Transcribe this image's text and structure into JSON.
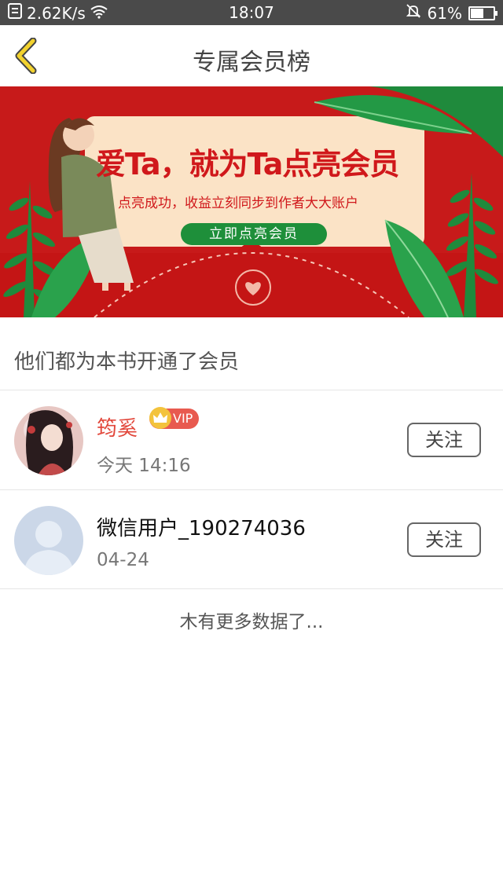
{
  "status_bar": {
    "speed": "2.62K/s",
    "time": "18:07",
    "battery": "61%",
    "battery_level": 0.61
  },
  "header": {
    "title": "专属会员榜"
  },
  "banner": {
    "headline": "爱Ta，就为Ta点亮会员",
    "subtitle": "点亮成功，收益立刻同步到作者大大账户",
    "button_label": "立即点亮会员"
  },
  "section": {
    "title": "他们都为本书开通了会员"
  },
  "members": [
    {
      "name": "筠奚",
      "time": "今天 14:16",
      "badge": "VIP",
      "follow_label": "关注"
    },
    {
      "name": "微信用户_190274036",
      "time": "04-24",
      "follow_label": "关注"
    }
  ],
  "footer": {
    "no_more": "木有更多数据了..."
  },
  "colors": {
    "accent_red": "#d0181b",
    "vip_name": "#e2473b",
    "button_green": "#1e8f3a",
    "back_yellow": "#f2d22e"
  }
}
